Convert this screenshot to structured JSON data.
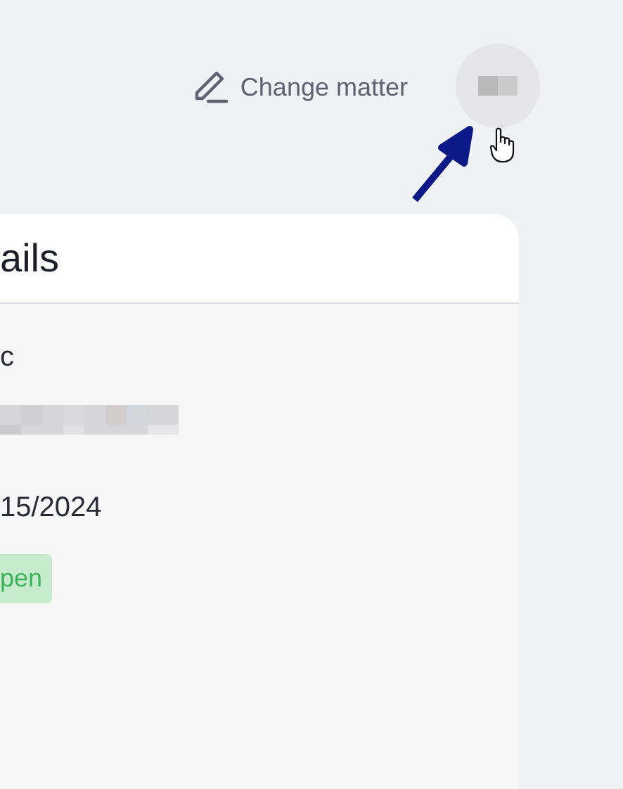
{
  "header": {
    "change_matter": "Change matter"
  },
  "card": {
    "title": "ails",
    "fields": [
      {
        "kind": "text",
        "value": "c"
      },
      {
        "kind": "redacted"
      },
      {
        "kind": "text",
        "value": "15/2024"
      },
      {
        "kind": "badge",
        "value": "pen"
      }
    ]
  }
}
